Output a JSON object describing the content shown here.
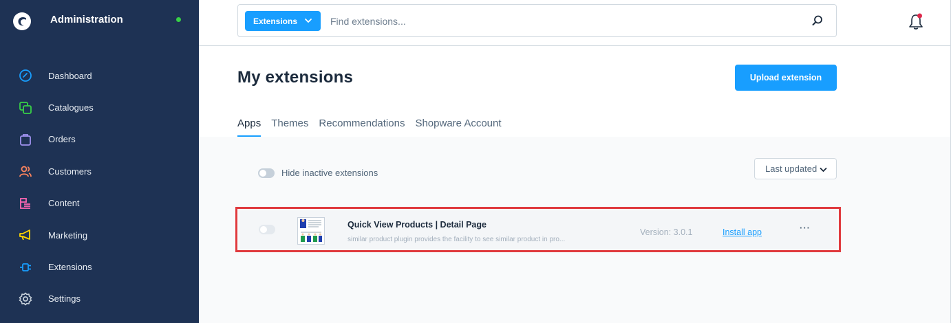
{
  "app": {
    "title": "Administration",
    "status_color": "#37d046",
    "accent_color": "#189eff",
    "sidebar_color": "#1e3254"
  },
  "sidebar": {
    "items": [
      {
        "label": "Dashboard",
        "icon": "dashboard-gauge-icon",
        "color": "#189eff"
      },
      {
        "label": "Catalogues",
        "icon": "catalogues-icon",
        "color": "#37d046"
      },
      {
        "label": "Orders",
        "icon": "orders-bag-icon",
        "color": "#a092f0"
      },
      {
        "label": "Customers",
        "icon": "customers-icon",
        "color": "#ff855e"
      },
      {
        "label": "Content",
        "icon": "content-icon",
        "color": "#ff68b4"
      },
      {
        "label": "Marketing",
        "icon": "marketing-megaphone-icon",
        "color": "#ffd700"
      },
      {
        "label": "Extensions",
        "icon": "extensions-plug-icon",
        "color": "#189eff"
      },
      {
        "label": "Settings",
        "icon": "settings-gear-icon",
        "color": "#9aa8b5"
      }
    ]
  },
  "search": {
    "scope_label": "Extensions",
    "placeholder": "Find extensions..."
  },
  "notifications": {
    "badge_color": "#de294c"
  },
  "page": {
    "title": "My extensions",
    "upload_label": "Upload extension",
    "tabs": [
      {
        "label": "Apps",
        "active": true
      },
      {
        "label": "Themes",
        "active": false
      },
      {
        "label": "Recommendations",
        "active": false
      },
      {
        "label": "Shopware Account",
        "active": false
      }
    ],
    "hide_inactive_label": "Hide inactive extensions",
    "sort_label": "Last updated"
  },
  "extensions": [
    {
      "name": "Quick View Products | Detail Page",
      "description": "similar product plugin provides the facility to see similar product in pro...",
      "version": "Version: 3.0.1",
      "action_label": "Install app",
      "more_label": "···",
      "highlight_color": "#e03a3e"
    }
  ]
}
